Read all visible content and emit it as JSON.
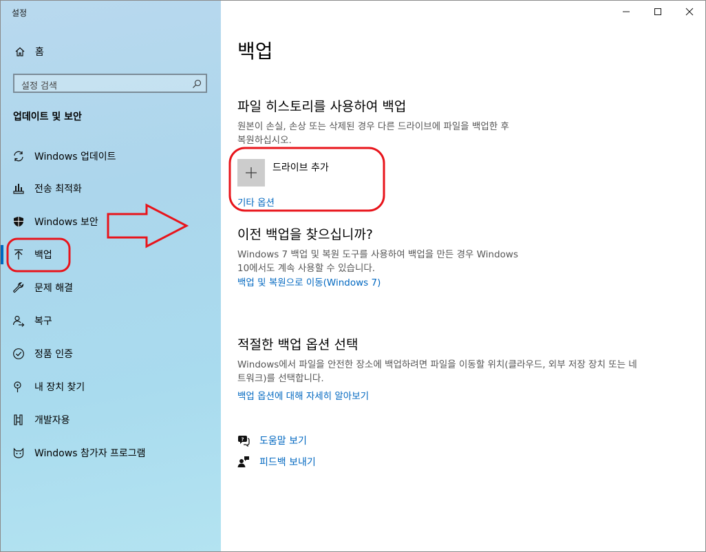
{
  "app": {
    "title": "설정"
  },
  "sidebar": {
    "home_label": "홈",
    "search_placeholder": "설정 검색",
    "section_title": "업데이트 및 보안",
    "items": [
      {
        "label": "Windows 업데이트",
        "icon": "sync-icon"
      },
      {
        "label": "전송 최적화",
        "icon": "delivery-optimization-icon"
      },
      {
        "label": "Windows 보안",
        "icon": "shield-icon"
      },
      {
        "label": "백업",
        "icon": "backup-arrow-icon",
        "selected": true
      },
      {
        "label": "문제 해결",
        "icon": "wrench-icon"
      },
      {
        "label": "복구",
        "icon": "recovery-icon"
      },
      {
        "label": "정품 인증",
        "icon": "check-circle-icon"
      },
      {
        "label": "내 장치 찾기",
        "icon": "find-device-icon"
      },
      {
        "label": "개발자용",
        "icon": "developer-icon"
      },
      {
        "label": "Windows 참가자 프로그램",
        "icon": "insider-cat-icon"
      }
    ]
  },
  "page": {
    "title": "백업",
    "file_history": {
      "heading": "파일 히스토리를 사용하여 백업",
      "desc_line1": "원본이 손실, 손상 또는 삭제된 경우 다른 드라이브에 파일을 백업한 후",
      "desc_line2": "복원하십시오.",
      "add_drive_label": "드라이브 추가",
      "more_options_link": "기타 옵션"
    },
    "older_backup": {
      "heading": "이전 백업을 찾으십니까?",
      "desc_line1": "Windows 7 백업 및 복원 도구를 사용하여 백업을 만든 경우 Windows",
      "desc_line2": "10에서도 계속 사용할 수 있습니다.",
      "link": "백업 및 복원으로 이동(Windows 7)"
    },
    "right_option": {
      "heading": "적절한 백업 옵션 선택",
      "desc_line1": "Windows에서 파일을 안전한 장소에 백업하려면 파일을 이동할 위치(클라우드, 외부 저장 장치 또는 네",
      "desc_line2": "트워크)를 선택합니다.",
      "link": "백업 옵션에 대해 자세히 알아보기"
    },
    "help": {
      "get_help": "도움말 보기",
      "give_feedback": "피드백 보내기"
    }
  },
  "colors": {
    "accent": "#0067c0",
    "annotation_red": "#e8141b",
    "sidebar_bg": "#acd6ec"
  }
}
